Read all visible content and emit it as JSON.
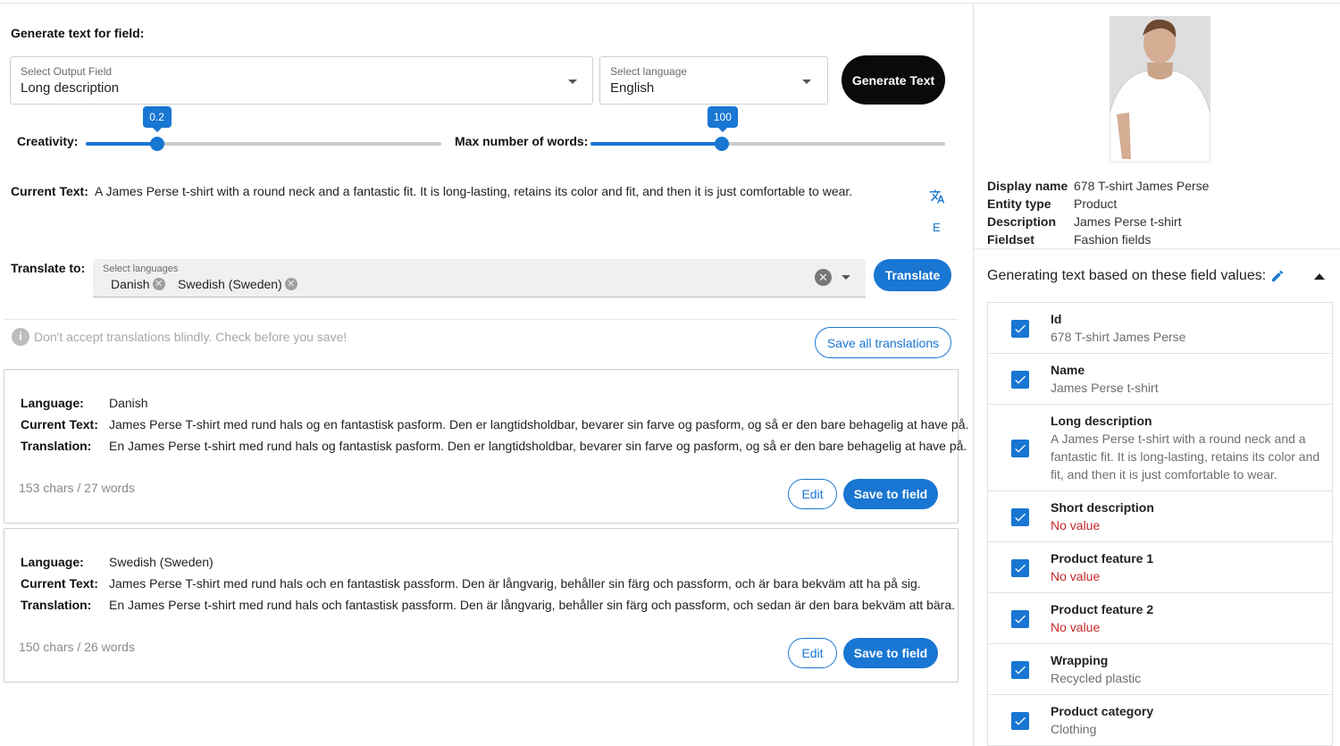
{
  "generate": {
    "title": "Generate text for field:",
    "output_field": {
      "label": "Select Output Field",
      "value": "Long description"
    },
    "language": {
      "label": "Select language",
      "value": "English"
    },
    "generate_button": "Generate Text"
  },
  "sliders": {
    "creativity": {
      "label": "Creativity:",
      "value": "0.2",
      "fraction": 0.2
    },
    "max_words": {
      "label": "Max number of words:",
      "value": "100",
      "fraction": 0.37
    }
  },
  "current": {
    "label": "Current Text:",
    "text": "A James Perse t-shirt with a round neck and a fantastic fit. It is long-lasting, retains its color and fit, and then it is just comfortable to wear.",
    "translate_icon": "translate-icon",
    "e_label": "E"
  },
  "translate": {
    "label": "Translate to:",
    "select_label": "Select languages",
    "chips": [
      "Danish",
      "Swedish (Sweden)"
    ],
    "button": "Translate"
  },
  "notice": {
    "text": "Don't accept translations blindly. Check before you save!",
    "save_all": "Save all translations"
  },
  "translations": [
    {
      "lang_label": "Language:",
      "language": "Danish",
      "current_label": "Current Text:",
      "current": "James Perse T-shirt med rund hals og en fantastisk pasform. Den er langtidsholdbar, bevarer sin farve og pasform, og så er den bare behagelig at have på.",
      "translation_label": "Translation:",
      "translation": "En James Perse t-shirt med rund hals og fantastisk pasform. Den er langtidsholdbar, bevarer sin farve og pasform, og så er den bare behagelig at have på.",
      "count": "153 chars / 27 words",
      "edit": "Edit",
      "save": "Save to field"
    },
    {
      "lang_label": "Language:",
      "language": "Swedish (Sweden)",
      "current_label": "Current Text:",
      "current": "James Perse T-shirt med rund hals och en fantastisk passform. Den är långvarig, behåller sin färg och passform, och är bara bekväm att ha på sig.",
      "translation_label": "Translation:",
      "translation": "En James Perse t-shirt med rund hals och fantastisk passform. Den är långvarig, behåller sin färg och passform, och sedan är den bara bekväm att bära.",
      "count": "150 chars / 26 words",
      "edit": "Edit",
      "save": "Save to field"
    }
  ],
  "product": {
    "meta": [
      {
        "k": "Display name",
        "v": "678 T-shirt James Perse"
      },
      {
        "k": "Entity type",
        "v": "Product"
      },
      {
        "k": "Description",
        "v": "James Perse t-shirt"
      },
      {
        "k": "Fieldset",
        "v": "Fashion fields"
      }
    ],
    "based_title": "Generating text based on these field values:",
    "fields": [
      {
        "name": "Id",
        "value": "678 T-shirt James Perse",
        "none": false
      },
      {
        "name": "Name",
        "value": "James Perse t-shirt",
        "none": false
      },
      {
        "name": "Long description",
        "value": "A James Perse t-shirt with a round neck and a fantastic fit. It is long-lasting, retains its color and fit, and then it is just comfortable to wear.",
        "none": false
      },
      {
        "name": "Short description",
        "value": "No value",
        "none": true
      },
      {
        "name": "Product feature 1",
        "value": "No value",
        "none": true
      },
      {
        "name": "Product feature 2",
        "value": "No value",
        "none": true
      },
      {
        "name": "Wrapping",
        "value": "Recycled plastic",
        "none": false
      },
      {
        "name": "Product category",
        "value": "Clothing",
        "none": false
      }
    ]
  },
  "colors": {
    "accent": "#1976d2",
    "error": "#c62828"
  }
}
